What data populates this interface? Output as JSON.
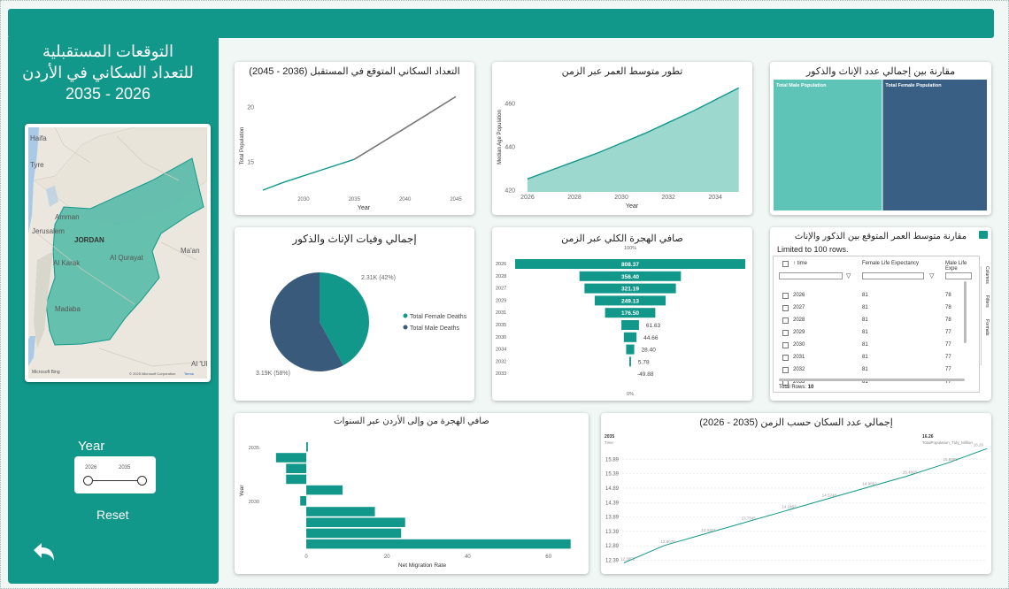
{
  "header": {
    "title_line1": "التوقعات المستقبلية",
    "title_line2": "للتعداد  السكاني في الأردن",
    "title_line3": "2026 - 2035"
  },
  "map": {
    "labels": [
      "Tyre",
      "Amman",
      "Jerusalem",
      "JORDAN",
      "Al Qurayat",
      "Al Karak",
      "Madaba",
      "Ma'an",
      "Al 'Ula",
      "Haifa"
    ],
    "copyright": "© 2025 Microsoft Corporation",
    "terms": "Terms",
    "brand": "Microsoft Bing"
  },
  "slicer": {
    "label": "Year",
    "from": "2026",
    "to": "2035"
  },
  "buttons": {
    "reset": "Reset"
  },
  "charts": {
    "forecast_title": "التعداد السكاني المتوقع في المستقبل (2036 - 2045)",
    "forecast_ylabel": "Total Population",
    "forecast_xlabel": "Year",
    "median_title": "تطور متوسط العمر عبر الزمن",
    "median_ylabel": "Median Age Population",
    "median_xlabel": "Year",
    "treemap_title": "مقارنة بين إجمالي عدد الإناث والذكور",
    "treemap_male": "Total Male Population",
    "treemap_female": "Total Female Population",
    "deaths_title": "إجمالي وفيات الإناث والذكور",
    "deaths_female_label": "2.31K (42%)",
    "deaths_male_label": "3.19K (58%)",
    "deaths_legend_female": "Total Female Deaths",
    "deaths_legend_male": "Total Male Deaths",
    "funnel_title": "صافي الهجرة الكلي عبر الزمن",
    "funnel_top_pct": "100%",
    "funnel_bottom_pct": "0%",
    "table_title": "مقارنة متوسط العمر المتوقع بين الذكور والإناث",
    "table_limit": "Limited to 100 rows.",
    "table_col_time": "time",
    "table_col_female": "Female Life Expectancy",
    "table_col_male": "Male Life Expe",
    "table_total": "Total Rows:",
    "table_total_value": "10",
    "pane_tabs": [
      "Columns",
      "Filters",
      "Formats"
    ],
    "migration_title": "صافي الهجرة من وإلى الأردن عبر السنوات",
    "migration_xlabel": "Net Migration Rate",
    "migration_ylabel": "Year",
    "pop_title": "إجمالي عدد السكان حسب الزمن (2035 - 2026)",
    "pop_tooltip_year": "2035",
    "pop_tooltip_year_label": "Time",
    "pop_tooltip_value": "16.26",
    "pop_tooltip_value_label": "TotalPopulation_Tidy_Million"
  },
  "chart_data": [
    {
      "type": "line",
      "title": "التعداد السكاني المتوقع في المستقبل (2036 - 2045)",
      "xlabel": "Year",
      "ylabel": "Total Population",
      "x_ticks": [
        2030,
        2035,
        2040,
        2045
      ],
      "y_ticks": [
        15,
        20
      ],
      "xlim": [
        2026,
        2045
      ],
      "ylim": [
        12,
        21
      ],
      "series": [
        {
          "name": "actual",
          "x": [
            2026,
            2028,
            2030,
            2032,
            2034,
            2035
          ],
          "y": [
            12.4,
            13.1,
            13.7,
            14.3,
            14.9,
            15.2
          ]
        },
        {
          "name": "forecast",
          "x": [
            2035,
            2038,
            2041,
            2045
          ],
          "y": [
            15.2,
            16.9,
            18.6,
            20.9
          ]
        }
      ]
    },
    {
      "type": "area",
      "title": "تطور متوسط العمر عبر الزمن",
      "xlabel": "Year",
      "ylabel": "Median Age Population",
      "x_ticks": [
        2026,
        2028,
        2030,
        2032,
        2034
      ],
      "y_ticks": [
        420,
        440,
        460
      ],
      "xlim": [
        2025.7,
        2035.2
      ],
      "ylim": [
        419,
        470
      ],
      "x": [
        2026,
        2027,
        2028,
        2029,
        2030,
        2031,
        2032,
        2033,
        2034,
        2035
      ],
      "y": [
        425,
        429,
        433,
        437,
        441.5,
        446,
        451,
        456,
        461.5,
        467
      ]
    },
    {
      "type": "heatmap",
      "title": "مقارنة بين إجمالي عدد الإناث والذكور",
      "categories": [
        "Total Male Population",
        "Total Female Population"
      ],
      "values": [
        51,
        49
      ]
    },
    {
      "type": "pie",
      "title": "إجمالي وفيات الإناث والذكور",
      "categories": [
        "Total Female Deaths",
        "Total Male Deaths"
      ],
      "values": [
        2.31,
        3.19
      ],
      "labels": [
        "2.31K (42%)",
        "3.19K (58%)"
      ],
      "colors": [
        "#12988a",
        "#3a5a7b"
      ]
    },
    {
      "type": "bar",
      "title": "صافي الهجرة الكلي عبر الزمن",
      "categories": [
        "2026",
        "2028",
        "2027",
        "2029",
        "2031",
        "2035",
        "2030",
        "2034",
        "2032",
        "2033"
      ],
      "values": [
        808.37,
        356.4,
        321.19,
        249.13,
        176.5,
        61.63,
        44.66,
        28.4,
        5.78,
        -49.88
      ],
      "labels": [
        "808.37",
        "356.40",
        "321.19",
        "249.13",
        "176.50",
        "61.63",
        "44.66",
        "28.40",
        "5.78",
        "-49.88"
      ]
    },
    {
      "type": "table",
      "title": "مقارنة متوسط العمر المتوقع بين الذكور والإناث",
      "columns": [
        "time",
        "Female Life Expectancy",
        "Male Life Expe"
      ],
      "rows": [
        [
          "2026",
          "81",
          "78"
        ],
        [
          "2027",
          "81",
          "78"
        ],
        [
          "2028",
          "81",
          "78"
        ],
        [
          "2029",
          "81",
          "77"
        ],
        [
          "2030",
          "81",
          "77"
        ],
        [
          "2031",
          "81",
          "77"
        ],
        [
          "2032",
          "81",
          "77"
        ],
        [
          "2033",
          "81",
          "77"
        ]
      ]
    },
    {
      "type": "bar",
      "title": "صافي الهجرة من وإلى الأردن عبر السنوات",
      "xlabel": "Net Migration Rate",
      "ylabel": "Year",
      "y_tick_labels": [
        "2035",
        "2030"
      ],
      "x_ticks": [
        0,
        20,
        40,
        60
      ],
      "xlim": [
        -9,
        66
      ],
      "categories": [
        "2035",
        "2034",
        "2033",
        "2032",
        "2031",
        "2030",
        "2029",
        "2028",
        "2027",
        "2026"
      ],
      "values": [
        0.4,
        -7.5,
        -5.0,
        -5.0,
        9.0,
        -1.5,
        17.0,
        24.5,
        23.5,
        65.5
      ]
    },
    {
      "type": "line",
      "title": "إجمالي عدد السكان حسب الزمن (2035 - 2026)",
      "y_ticks": [
        12.39,
        12.89,
        13.39,
        13.89,
        14.39,
        14.89,
        15.39,
        15.89
      ],
      "ylim": [
        12.25,
        16.3
      ],
      "x": [
        2026,
        2027,
        2028,
        2029,
        2030,
        2031,
        2032,
        2033,
        2034,
        2035
      ],
      "y": [
        12.3,
        12.9,
        13.3,
        13.7,
        14.1,
        14.5,
        14.9,
        15.3,
        15.75,
        16.26
      ],
      "labels": [
        "12.3052",
        "12.8078",
        "13.3183",
        "13.7345",
        "14.1883",
        "14.5248",
        "14.9852",
        "15.4993",
        "15.8068",
        "16.26"
      ]
    }
  ]
}
